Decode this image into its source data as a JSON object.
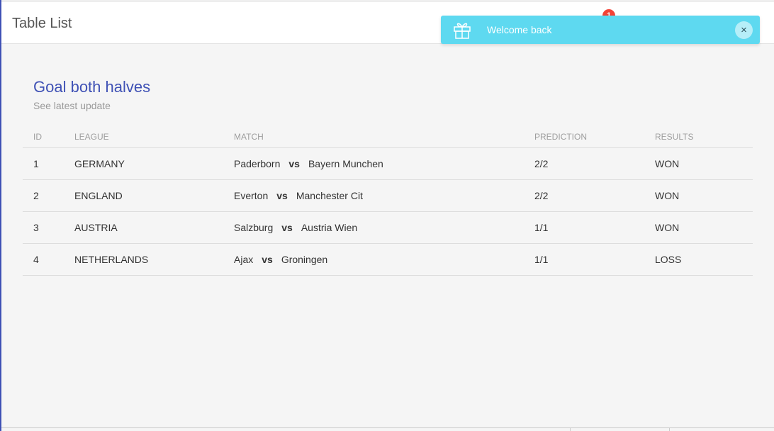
{
  "navbar": {
    "title": "Table List",
    "notification_count": "1"
  },
  "toast": {
    "icon": "gift-icon",
    "message": "Welcome back",
    "close_label": "×",
    "color": "#5ed9f0"
  },
  "card": {
    "title": "Goal both halves",
    "subtitle": "See latest update",
    "title_color": "#3f51b5"
  },
  "table": {
    "headers": {
      "id": "ID",
      "league": "LEAGUE",
      "match": "MATCH",
      "prediction": "PREDICTION",
      "results": "RESULTS"
    },
    "rows": [
      {
        "id": "1",
        "league": "GERMANY",
        "home": "Paderborn",
        "vs": "vs",
        "away": "Bayern Munchen",
        "prediction": "2/2",
        "result": "WON"
      },
      {
        "id": "2",
        "league": "ENGLAND",
        "home": "Everton",
        "vs": "vs",
        "away": "Manchester Cit",
        "prediction": "2/2",
        "result": "WON"
      },
      {
        "id": "3",
        "league": "AUSTRIA",
        "home": "Salzburg",
        "vs": "vs",
        "away": "Austria Wien",
        "prediction": "1/1",
        "result": "WON"
      },
      {
        "id": "4",
        "league": "NETHERLANDS",
        "home": "Ajax",
        "vs": "vs",
        "away": "Groningen",
        "prediction": "1/1",
        "result": "LOSS"
      }
    ]
  }
}
